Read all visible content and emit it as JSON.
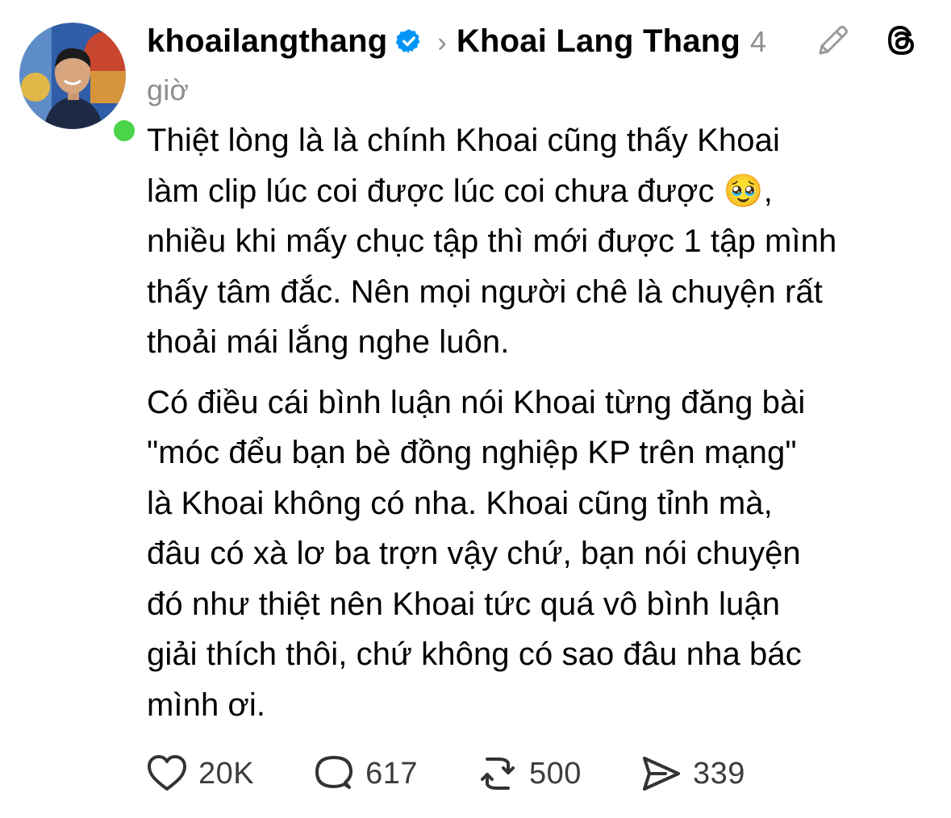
{
  "post": {
    "username": "khoailangthang",
    "verified": true,
    "topic": "Khoai Lang Thang",
    "time": "4 giờ",
    "paragraphs": [
      "Thiệt lòng là là chính Khoai cũng thấy Khoai\nlàm clip lúc coi được lúc coi chưa được 🥹,\nnhiều khi mấy chục tập thì mới được 1 tập mình\nthấy tâm đắc. Nên mọi người chê là chuyện rất\nthoải mái lắng nghe luôn.",
      "Có điều cái bình luận nói Khoai từng đăng bài\n\"móc đểu bạn bè đồng nghiệp KP trên mạng\"\nlà Khoai không có nha. Khoai cũng tỉnh mà,\nđâu có xà lơ ba trợn vậy chứ, bạn nói chuyện\nđó như thiệt nên Khoai tức quá vô bình luận\ngiải thích thôi, chứ không có sao đâu nha bác\nmình ơi."
    ],
    "stats": {
      "likes": "20K",
      "comments": "617",
      "reposts": "500",
      "shares": "339"
    },
    "icons": {
      "like": "heart-icon",
      "comment": "comment-icon",
      "repost": "repost-icon",
      "share": "share-icon",
      "edit": "pencil-icon",
      "app": "threads-logo-icon",
      "verified": "verified-badge-icon"
    },
    "colors": {
      "verified": "#0095f6",
      "online": "#4ad54a",
      "muted": "#8e8e8e"
    }
  }
}
